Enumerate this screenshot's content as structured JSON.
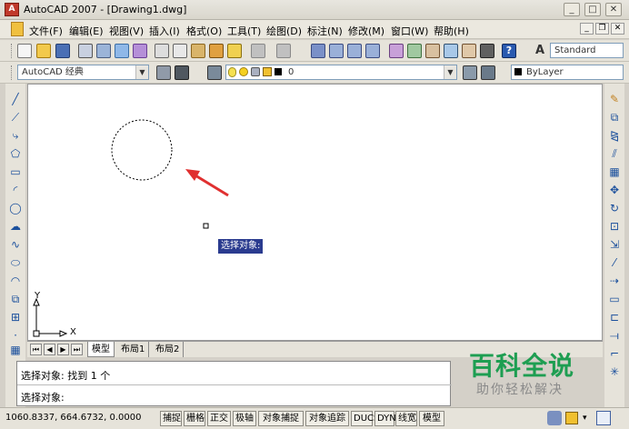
{
  "window": {
    "title": "AutoCAD 2007 - [Drawing1.dwg]",
    "logo": "A",
    "minimize_icon": "_",
    "maximize_icon": "□",
    "close_icon": "✕"
  },
  "menu": {
    "items": [
      {
        "label": "文件(F)"
      },
      {
        "label": "编辑(E)"
      },
      {
        "label": "视图(V)"
      },
      {
        "label": "插入(I)"
      },
      {
        "label": "格式(O)"
      },
      {
        "label": "工具(T)"
      },
      {
        "label": "绘图(D)"
      },
      {
        "label": "标注(N)"
      },
      {
        "label": "修改(M)"
      },
      {
        "label": "窗口(W)"
      },
      {
        "label": "帮助(H)"
      }
    ],
    "doc_min_icon": "_",
    "doc_restore_icon": "❐",
    "doc_close_icon": "✕"
  },
  "toolbar": {
    "text_style": "Standard",
    "workspace": "AutoCAD 经典",
    "layer": "0",
    "color": "ByLayer"
  },
  "canvas": {
    "ucs_y": "Y",
    "ucs_x": "X",
    "tooltip": "选择对象:"
  },
  "tabs": {
    "nav": [
      "⏮",
      "◀",
      "▶",
      "⏭"
    ],
    "items": [
      "模型",
      "布局1",
      "布局2"
    ]
  },
  "command": {
    "history": "选择对象: 找到 1 个",
    "prompt": "选择对象:"
  },
  "status": {
    "coordinates": "1060.8337,  664.6732,  0.0000",
    "buttons": [
      "捕捉",
      "栅格",
      "正交",
      "极轴",
      "对象捕捉",
      "对象追踪",
      "DUCS",
      "DYN",
      "线宽",
      "模型"
    ]
  },
  "watermark": {
    "title": "百科全说",
    "subtitle": "助你轻松解决"
  },
  "colors": {
    "arrow": "#e03030",
    "watermark_green": "#1e9e52",
    "tooltip_bg": "#2a3b8f"
  }
}
